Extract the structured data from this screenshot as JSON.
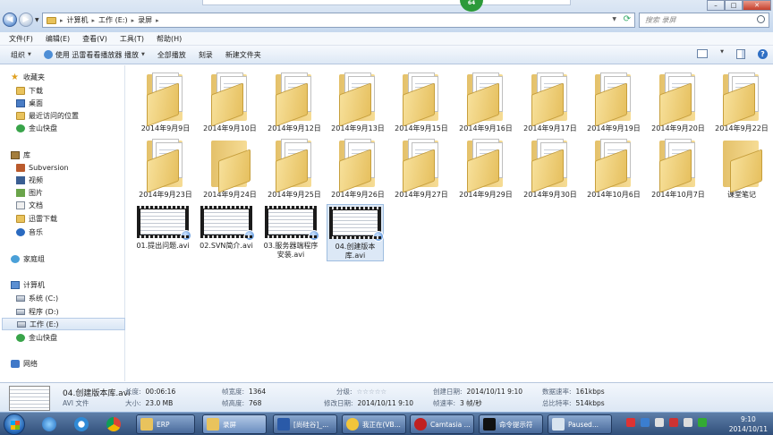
{
  "window": {
    "breadcrumb": [
      "计算机",
      "工作 (E:)",
      "录屏"
    ],
    "search_placeholder": "搜索 录屏",
    "timer_badge": "64"
  },
  "menu": [
    "文件(F)",
    "编辑(E)",
    "查看(V)",
    "工具(T)",
    "帮助(H)"
  ],
  "toolbar": {
    "organize": "组织",
    "play_with": "使用 迅雷看看播放器 播放",
    "play_all": "全部播放",
    "burn": "刻录",
    "new_folder": "新建文件夹"
  },
  "sidebar": {
    "favorites": "收藏夹",
    "favorites_items": [
      "下载",
      "桌面",
      "最近访问的位置",
      "金山快盘"
    ],
    "libraries": "库",
    "libraries_items": [
      "Subversion",
      "视频",
      "图片",
      "文档",
      "迅雷下载",
      "音乐"
    ],
    "homegroup": "家庭组",
    "computer": "计算机",
    "computer_items": [
      "系统 (C:)",
      "程序 (D:)",
      "工作 (E:)",
      "金山快盘"
    ],
    "network": "网络"
  },
  "folders": [
    "2014年9月9日",
    "2014年9月10日",
    "2014年9月12日",
    "2014年9月13日",
    "2014年9月15日",
    "2014年9月16日",
    "2014年9月17日",
    "2014年9月19日",
    "2014年9月20日",
    "2014年9月22日",
    "2014年9月23日",
    "2014年9月24日",
    "2014年9月25日",
    "2014年9月26日",
    "2014年9月27日",
    "2014年9月29日",
    "2014年9月30日",
    "2014年10月6日",
    "2014年10月7日",
    "课堂笔记"
  ],
  "videos": [
    "01.提出问题.avi",
    "02.SVN简介.avi",
    "03.服务器端程序安装.avi",
    "04.创建版本库.avi"
  ],
  "details": {
    "filename": "04.创建版本库.avi",
    "filetype": "AVI 文件",
    "length_label": "长度:",
    "length": "00:06:16",
    "size_label": "大小:",
    "size": "23.0 MB",
    "width_label": "帧宽度:",
    "width": "1364",
    "height_label": "帧高度:",
    "height": "768",
    "rating_label": "分级:",
    "rating": "☆☆☆☆☆",
    "modified_label": "修改日期:",
    "modified": "2014/10/11 9:10",
    "created_label": "创建日期:",
    "created": "2014/10/11 9:10",
    "framerate_label": "帧速率:",
    "framerate": "3 帧/秒",
    "datarate_label": "数据速率:",
    "datarate": "161kbps",
    "totalbitrate_label": "总比特率:",
    "totalbitrate": "514kbps"
  },
  "taskbar": {
    "tasks": [
      "ERP",
      "录屏",
      "[尚硅谷]_...",
      "我正在(VB...",
      "Camtasia ...",
      "命令提示符",
      "Paused..."
    ],
    "time": "9:10",
    "date": "2014/10/11"
  },
  "colors": {
    "folder": "#e9c35d",
    "selection": "#dce8f6",
    "taskbar": "#314f7a",
    "timer_badge": "#2c9a3a"
  }
}
